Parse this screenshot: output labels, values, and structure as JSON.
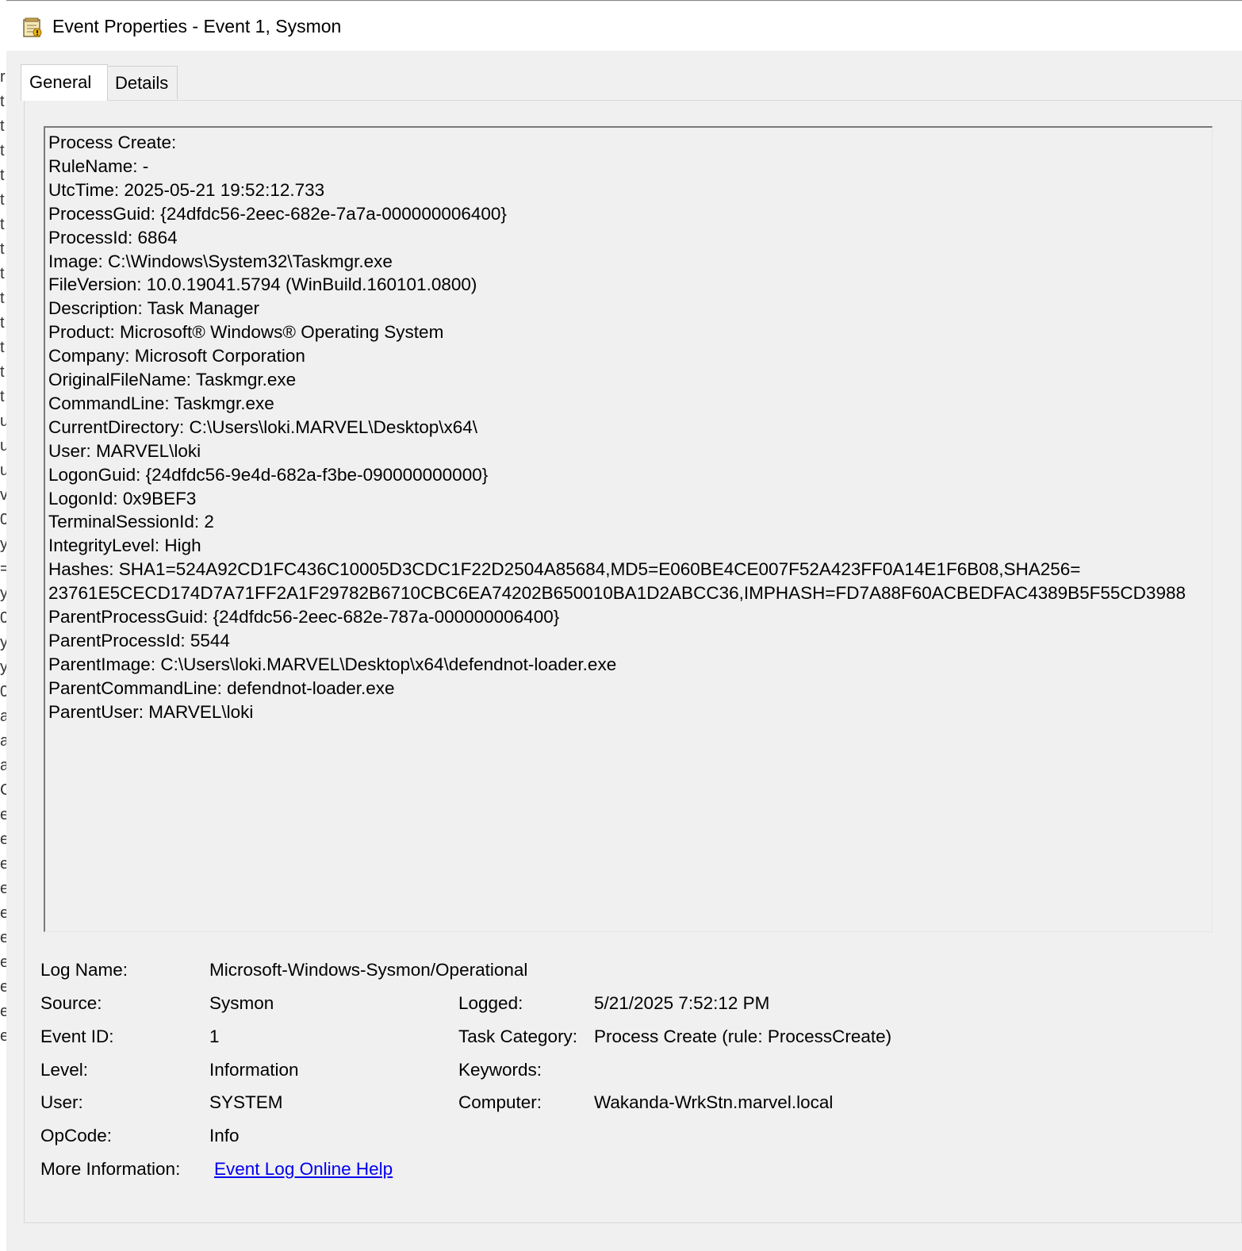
{
  "window": {
    "title": "Event Properties - Event 1, Sysmon",
    "icon": "event-viewer-icon"
  },
  "tabs": [
    {
      "label": "General",
      "active": true
    },
    {
      "label": "Details",
      "active": false
    }
  ],
  "description": [
    "Process Create:",
    "RuleName: -",
    "UtcTime: 2025-05-21 19:52:12.733",
    "ProcessGuid: {24dfdc56-2eec-682e-7a7a-000000006400}",
    "ProcessId: 6864",
    "Image: C:\\Windows\\System32\\Taskmgr.exe",
    "FileVersion: 10.0.19041.5794 (WinBuild.160101.0800)",
    "Description: Task Manager",
    "Product: Microsoft® Windows® Operating System",
    "Company: Microsoft Corporation",
    "OriginalFileName: Taskmgr.exe",
    "CommandLine: Taskmgr.exe",
    "CurrentDirectory: C:\\Users\\loki.MARVEL\\Desktop\\x64\\",
    "User: MARVEL\\loki",
    "LogonGuid: {24dfdc56-9e4d-682a-f3be-090000000000}",
    "LogonId: 0x9BEF3",
    "TerminalSessionId: 2",
    "IntegrityLevel: High",
    "Hashes: SHA1=524A92CD1FC436C10005D3CDC1F22D2504A85684,MD5=E060BE4CE007F52A423FF0A14E1F6B08,SHA256=",
    "23761E5CECD174D7A71FF2A1F29782B6710CBC6EA74202B650010BA1D2ABCC36,IMPHASH=FD7A88F60ACBEDFAC4389B5F55CD3988",
    "ParentProcessGuid: {24dfdc56-2eec-682e-787a-000000006400}",
    "ParentProcessId: 5544",
    "ParentImage: C:\\Users\\loki.MARVEL\\Desktop\\x64\\defendnot-loader.exe",
    "ParentCommandLine: defendnot-loader.exe",
    "ParentUser: MARVEL\\loki"
  ],
  "info": {
    "log_name_label": "Log Name:",
    "log_name": "Microsoft-Windows-Sysmon/Operational",
    "source_label": "Source:",
    "source": "Sysmon",
    "logged_label": "Logged:",
    "logged": "5/21/2025 7:52:12 PM",
    "event_id_label": "Event ID:",
    "event_id": "1",
    "task_category_label": "Task Category:",
    "task_category": "Process Create (rule: ProcessCreate)",
    "level_label": "Level:",
    "level": "Information",
    "keywords_label": "Keywords:",
    "keywords": "",
    "user_label": "User:",
    "user": "SYSTEM",
    "computer_label": "Computer:",
    "computer": "Wakanda-WrkStn.marvel.local",
    "opcode_label": "OpCode:",
    "opcode": "Info",
    "more_info_label": "More Information:",
    "more_info_link": "Event Log Online Help"
  },
  "left_strip_chars": [
    "r",
    "t",
    "t",
    "t",
    "t",
    "t",
    "t",
    "t",
    "t",
    "t",
    "t",
    "t",
    "t",
    "t",
    "u",
    "u",
    "u",
    "v",
    "0",
    "y",
    "=",
    "y",
    "0",
    "y",
    "y",
    "0",
    "a",
    "a",
    "a",
    "C",
    "e",
    "e",
    "e",
    "e",
    "e",
    "e",
    "e",
    "e",
    "e",
    "e"
  ],
  "colors": {
    "window_bg": "#f0f0f0",
    "link": "#0000ee",
    "border_dark": "#7a7a7a"
  }
}
